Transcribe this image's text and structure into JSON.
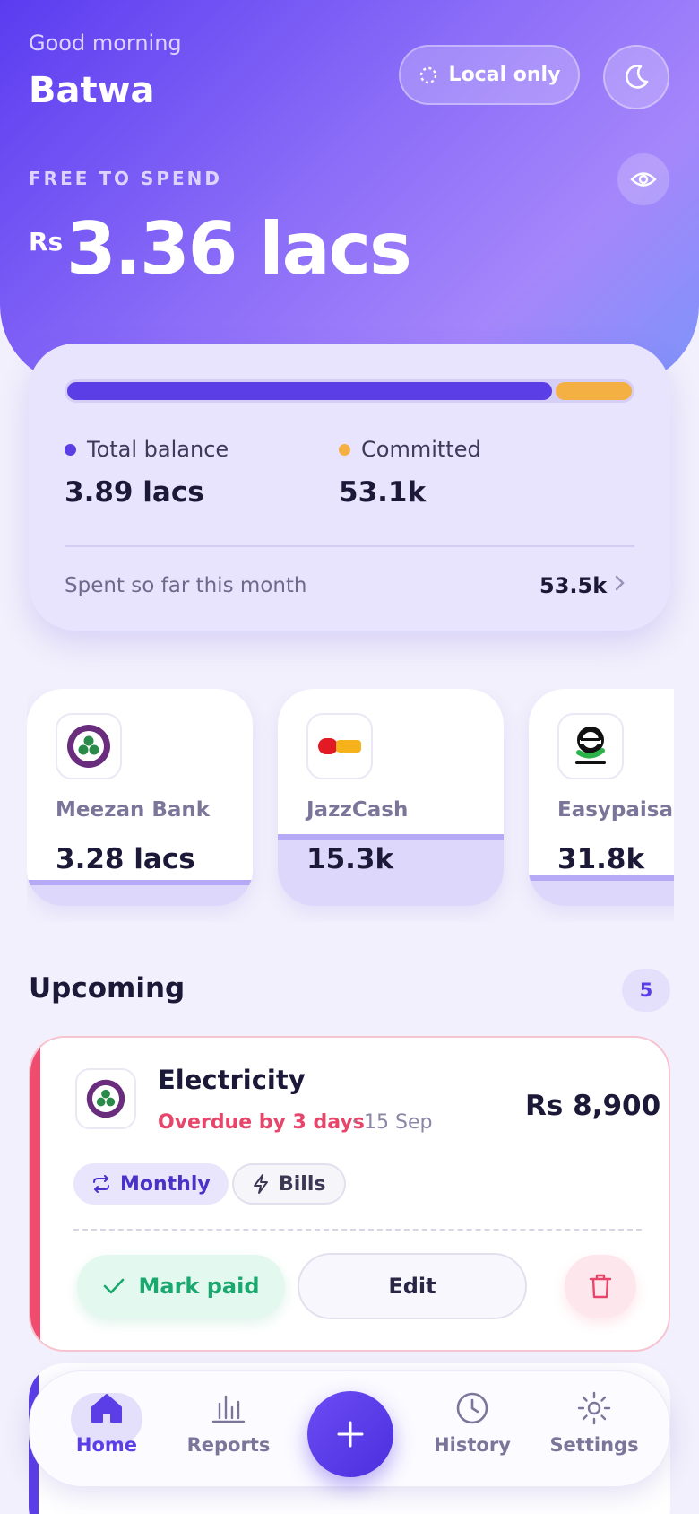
{
  "header": {
    "greeting": "Good morning",
    "user_name": "Batwa",
    "local_label": "Local only",
    "free_label": "FREE TO SPEND",
    "currency": "Rs",
    "free_amount": "3.36 lacs"
  },
  "balance": {
    "committed_fraction": 0.136,
    "total_label": "Total balance",
    "total_value": "3.89 lacs",
    "committed_label": "Committed",
    "committed_value": "53.1k",
    "spent_label": "Spent so far this month",
    "spent_value": "53.5k"
  },
  "accounts": [
    {
      "name": "Meezan Bank",
      "value": "3.28 lacs",
      "logo": "meezan-logo",
      "fill": 0.12
    },
    {
      "name": "JazzCash",
      "value": "15.3k",
      "logo": "jazzcash-logo",
      "fill": 0.33
    },
    {
      "name": "Easypaisa",
      "value": "31.8k",
      "logo": "easypaisa-logo",
      "fill": 0.14
    }
  ],
  "upcoming": {
    "title": "Upcoming",
    "count": "5",
    "bill": {
      "title": "Electricity",
      "status": "Overdue by 3 days",
      "date": "· 15 Sep",
      "amount": "Rs 8,900",
      "tag_repeat": "Monthly",
      "tag_category": "Bills",
      "mark_paid": "Mark paid",
      "edit": "Edit"
    }
  },
  "nav": {
    "home": "Home",
    "reports": "Reports",
    "history": "History",
    "settings": "Settings"
  },
  "colors": {
    "accent": "#5b3ee6",
    "committed": "#f5b043",
    "overdue": "#f04c70",
    "success": "#19a86e"
  },
  "icons": [
    "sync-icon",
    "moon-icon",
    "eye-icon",
    "chevron-right-icon",
    "repeat-icon",
    "bolt-icon",
    "check-icon",
    "trash-icon",
    "home-icon",
    "chart-icon",
    "plus-icon",
    "clock-icon",
    "sun-icon"
  ]
}
